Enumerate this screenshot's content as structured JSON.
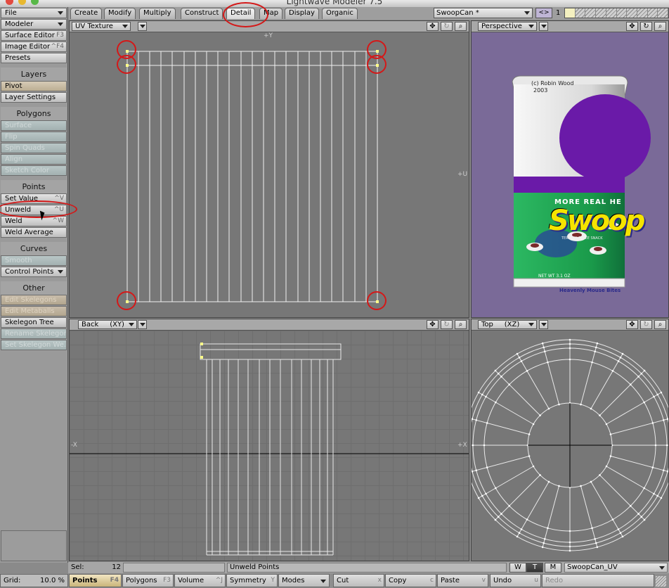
{
  "window": {
    "title": "Lightwave Modeler 7.5"
  },
  "sidebar": {
    "file": "File",
    "modeler": "Modeler",
    "surface_editor": {
      "label": "Surface Editor",
      "shortcut": "F3"
    },
    "image_editor": {
      "label": "Image Editor",
      "shortcut": "^F4"
    },
    "presets": "Presets",
    "layers_header": "Layers",
    "pivot": "Pivot",
    "layer_settings": "Layer Settings",
    "polygons_header": "Polygons",
    "surface": "Surface",
    "flip": "Flip",
    "spin_quads": "Spin Quads",
    "align": "Align",
    "sketch_color": "Sketch Color",
    "points_header": "Points",
    "set_value": {
      "label": "Set Value",
      "shortcut": "^V"
    },
    "unweld": {
      "label": "Unweld",
      "shortcut": "^U"
    },
    "weld": {
      "label": "Weld",
      "shortcut": "^W"
    },
    "weld_average": "Weld Average",
    "curves_header": "Curves",
    "smooth": "Smooth",
    "control_points": "Control Points",
    "other_header": "Other",
    "edit_skelegons": "Edit Skelegons",
    "edit_metaballs": "Edit Metaballs",
    "skelegon_tree": "Skelegon Tree",
    "rename_skelegon": "Rename Skelegon",
    "set_skelegon_weight": "Set Skelegon We..."
  },
  "tabs": [
    "Create",
    "Modify",
    "Multiply",
    "Construct",
    "Detail",
    "Map",
    "Display",
    "Organic"
  ],
  "active_tab": "Detail",
  "object": {
    "name": "SwoopCan *"
  },
  "layers": {
    "nav": "<>",
    "number": "1"
  },
  "viewports": {
    "uv": {
      "mode": "UV Texture",
      "axis_top": "+Y",
      "axis_right": "+U"
    },
    "perspective": {
      "mode": "Perspective"
    },
    "back": {
      "mode": "Back",
      "plane": "(XY)",
      "axis_left": "-X",
      "axis_right": "+X"
    },
    "top": {
      "mode": "Top",
      "plane": "(XZ)"
    }
  },
  "can": {
    "credit_line1": "(c) Robin Wood",
    "credit_line2": "2003",
    "tagline": "MORE REAL HE",
    "brand": "Swoop",
    "small_print": "TERRIFIC SPACE SNACK",
    "net_wt": "NET WT 3.1 OZ",
    "bottom_text": "Heavenly Mouse Bites"
  },
  "status": {
    "sel_label": "Sel:",
    "sel_value": "12",
    "info": "",
    "message": "Unweld Points",
    "w": "W",
    "t": "T",
    "m": "M",
    "uvmap": "SwoopCan_UV"
  },
  "bottombar": {
    "grid_label": "Grid:",
    "grid_value": "10.0 %",
    "points": {
      "label": "Points",
      "shortcut": "F4"
    },
    "polygons": {
      "label": "Polygons",
      "shortcut": "F3"
    },
    "volume": {
      "label": "Volume",
      "shortcut": "^J"
    },
    "symmetry": {
      "label": "Symmetry",
      "shortcut": "Y"
    },
    "modes": "Modes",
    "cut": {
      "label": "Cut",
      "shortcut": "x"
    },
    "copy": {
      "label": "Copy",
      "shortcut": "c"
    },
    "paste": {
      "label": "Paste",
      "shortcut": "v"
    },
    "undo": {
      "label": "Undo",
      "shortcut": "u"
    },
    "redo": "Redo"
  },
  "colors": {
    "annotation": "#d41818",
    "perspective_bg": "#7a6a98",
    "can_purple": "#6a1aa8",
    "can_green": "#1ea050",
    "swoop_yellow": "#f5e400"
  }
}
